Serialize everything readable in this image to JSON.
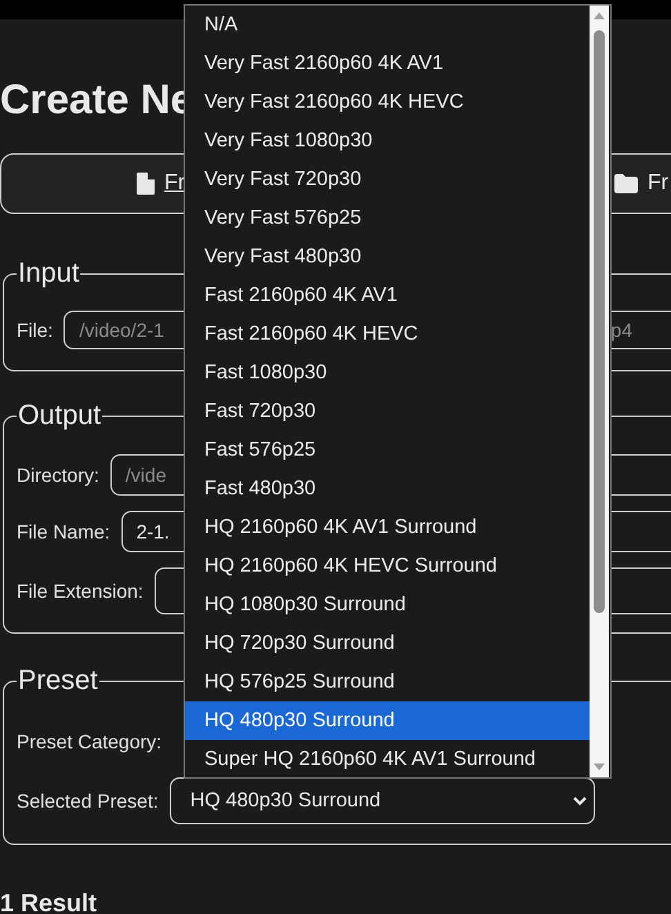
{
  "heading": "Create Ne",
  "source_tabs": [
    {
      "kind": "file",
      "label": "Fr",
      "selected": true
    },
    {
      "kind": "folder",
      "label": "Fr",
      "selected": false
    }
  ],
  "input": {
    "legend": "Input",
    "file": {
      "label": "File:",
      "placeholder_visible_parts": [
        "/video/2-1",
        "p4"
      ]
    }
  },
  "output": {
    "legend": "Output",
    "fields": [
      {
        "label": "Directory:",
        "placeholder": "/vide"
      },
      {
        "label": "File Name:",
        "value": "2-1."
      },
      {
        "label": "File Extension:"
      }
    ]
  },
  "preset": {
    "legend": "Preset",
    "category": {
      "label": "Preset Category:"
    },
    "selected_preset": {
      "label": "Selected Preset:",
      "value": "HQ 480p30 Surround"
    }
  },
  "dropdown_options": [
    {
      "label": "N/A",
      "selected": false
    },
    {
      "label": "Very Fast 2160p60 4K AV1",
      "selected": false
    },
    {
      "label": "Very Fast 2160p60 4K HEVC",
      "selected": false
    },
    {
      "label": "Very Fast 1080p30",
      "selected": false
    },
    {
      "label": "Very Fast 720p30",
      "selected": false
    },
    {
      "label": "Very Fast 576p25",
      "selected": false
    },
    {
      "label": "Very Fast 480p30",
      "selected": false
    },
    {
      "label": "Fast 2160p60 4K AV1",
      "selected": false
    },
    {
      "label": "Fast 2160p60 4K HEVC",
      "selected": false
    },
    {
      "label": "Fast 1080p30",
      "selected": false
    },
    {
      "label": "Fast 720p30",
      "selected": false
    },
    {
      "label": "Fast 576p25",
      "selected": false
    },
    {
      "label": "Fast 480p30",
      "selected": false
    },
    {
      "label": "HQ 2160p60 4K AV1 Surround",
      "selected": false
    },
    {
      "label": "HQ 2160p60 4K HEVC Surround",
      "selected": false
    },
    {
      "label": "HQ 1080p30 Surround",
      "selected": false
    },
    {
      "label": "HQ 720p30 Surround",
      "selected": false
    },
    {
      "label": "HQ 576p25 Surround",
      "selected": false
    },
    {
      "label": "HQ 480p30 Surround",
      "selected": true
    },
    {
      "label": "Super HQ 2160p60 4K AV1 Surround",
      "selected": false
    }
  ],
  "results": {
    "count": "1 Result"
  }
}
